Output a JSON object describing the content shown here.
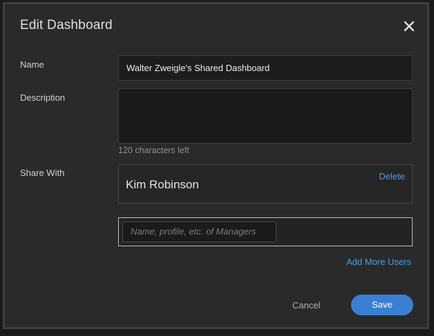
{
  "dialog": {
    "title": "Edit Dashboard",
    "close_icon": "close-icon"
  },
  "form": {
    "name_label": "Name",
    "name_value": "Walter Zweigle's Shared Dashboard",
    "description_label": "Description",
    "description_value": "",
    "characters_left": "120 characters left",
    "share_label": "Share With",
    "shared_users": [
      {
        "name": "Kim Robinson",
        "delete_label": "Delete"
      }
    ],
    "user_search_placeholder": "Name, profile, etc. of Managers",
    "add_more_label": "Add More Users"
  },
  "actions": {
    "cancel_label": "Cancel",
    "save_label": "Save"
  },
  "colors": {
    "accent": "#3a7fd4",
    "link": "#4d9ae0",
    "dialog_bg": "#2a2a2a"
  }
}
